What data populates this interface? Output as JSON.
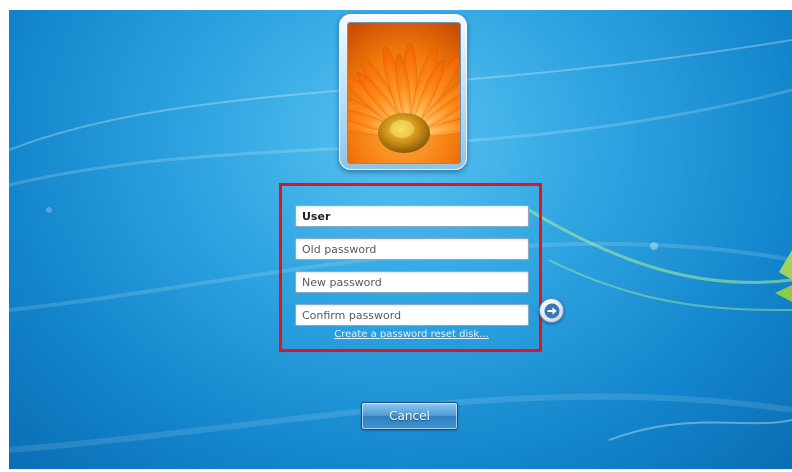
{
  "login_screen": {
    "user_field": {
      "value": "User"
    },
    "old_password_field": {
      "placeholder": "Old password"
    },
    "new_password_field": {
      "placeholder": "New password"
    },
    "confirm_password_field": {
      "placeholder": "Confirm password"
    },
    "submit_arrow": {
      "icon": "arrow-right-icon"
    },
    "reset_disk_link": {
      "label": "Create a password reset disk..."
    },
    "cancel_button": {
      "label": "Cancel"
    },
    "avatar": {
      "icon": "flower-avatar"
    }
  },
  "colors": {
    "highlight_border": "#e1151a",
    "background_blue": "#1b8fd6",
    "flower_orange": "#f47a0c"
  }
}
